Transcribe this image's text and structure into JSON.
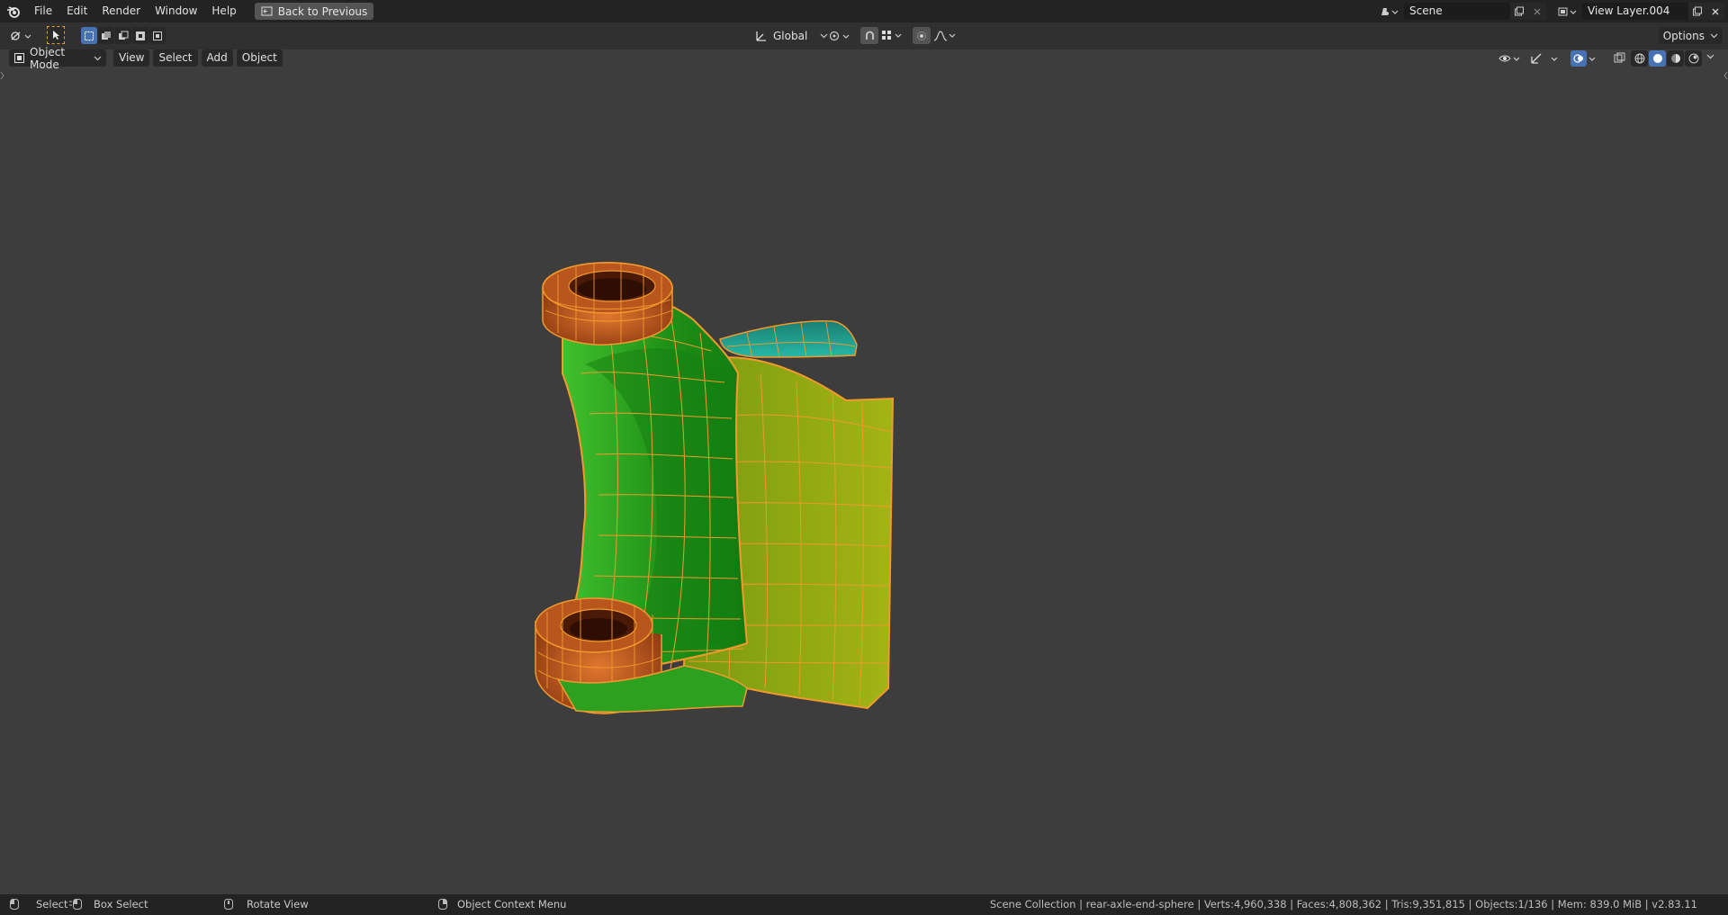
{
  "menu": {
    "items": [
      "File",
      "Edit",
      "Render",
      "Window",
      "Help"
    ],
    "back_label": "Back to Previous"
  },
  "scene": {
    "name": "Scene",
    "view_layer": "View Layer.004"
  },
  "toolbar": {
    "orientation": "Global",
    "options": "Options"
  },
  "viewport_header": {
    "mode": "Object Mode",
    "menus": [
      "View",
      "Select",
      "Add",
      "Object"
    ]
  },
  "status": {
    "select": "Select",
    "box_select": "Box Select",
    "rotate_view": "Rotate View",
    "context_menu": "Object Context Menu",
    "stats": "Scene Collection | rear-axle-end-sphere | Verts:4,960,338 | Faces:4,808,362 | Tris:9,351,815 | Objects:1/136 | Mem: 839.0 MiB | v2.83.11"
  },
  "colors": {
    "accent": "#4772b3",
    "selection_outline": "#f29a2e",
    "green": "#2ca01c",
    "yellow": "#8ea80e",
    "teal": "#1f9f8f",
    "orange_copper": "#b9521c"
  }
}
